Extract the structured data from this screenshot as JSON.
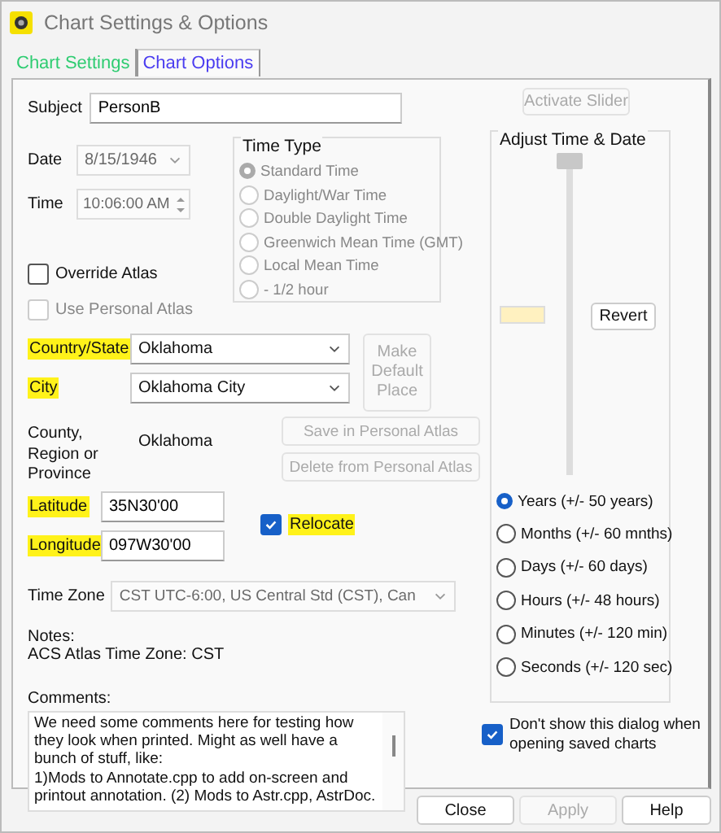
{
  "window": {
    "title": "Chart Settings & Options"
  },
  "tabs": [
    {
      "label": "Chart Settings",
      "selected": false,
      "color": "#2ecc71"
    },
    {
      "label": "Chart Options",
      "selected": true,
      "color": "#4a3cf0"
    }
  ],
  "subject": {
    "label": "Subject",
    "value": "PersonB"
  },
  "date": {
    "label": "Date",
    "value": "8/15/1946",
    "disabled": true
  },
  "time": {
    "label": "Time",
    "value": "10:06:00 AM",
    "disabled": true
  },
  "time_type": {
    "title": "Time Type",
    "disabled": true,
    "options": [
      {
        "label": "Standard Time",
        "selected": true
      },
      {
        "label": "Daylight/War Time",
        "selected": false
      },
      {
        "label": "Double Daylight Time",
        "selected": false
      },
      {
        "label": "Greenwich Mean Time (GMT)",
        "selected": false
      },
      {
        "label": "Local Mean Time",
        "selected": false
      },
      {
        "label": "- 1/2 hour",
        "selected": false
      }
    ]
  },
  "atlas_options": [
    {
      "label": "Override Atlas",
      "checked": false,
      "disabled": false
    },
    {
      "label": "Use Personal Atlas",
      "checked": false,
      "disabled": true
    }
  ],
  "country": {
    "label": "Country/State",
    "highlighted": true,
    "value": "Oklahoma"
  },
  "city": {
    "label": "City",
    "highlighted": true,
    "value": "Oklahoma City"
  },
  "make_default": {
    "label": "Make Default Place",
    "disabled": true
  },
  "county": {
    "label": "County, Region or Province",
    "value": "Oklahoma"
  },
  "atlas_buttons": [
    {
      "label": "Save in Personal Atlas",
      "disabled": true
    },
    {
      "label": "Delete from Personal Atlas",
      "disabled": true
    }
  ],
  "latitude": {
    "label": "Latitude",
    "highlighted": true,
    "value": "35N30'00"
  },
  "longitude": {
    "label": "Longitude",
    "highlighted": true,
    "value": "097W30'00"
  },
  "relocate": {
    "label": "Relocate",
    "checked": true,
    "highlighted": true
  },
  "time_zone": {
    "label": "Time Zone",
    "value": "CST UTC-6:00, US Central Std (CST), Can",
    "disabled": true
  },
  "notes": {
    "label": "Notes:",
    "text": "ACS Atlas Time Zone: CST"
  },
  "comments": {
    "label": "Comments:",
    "value": "We need some comments here for testing how they look when printed. Might as well have a bunch of stuff, like:\n1)Mods to Annotate.cpp to add on-screen and printout annotation. (2) Mods to Astr.cpp, AstrDoc."
  },
  "activate_slider": {
    "label": "Activate Slider",
    "disabled": true
  },
  "adjust": {
    "title": "Adjust Time & Date",
    "level": 0,
    "revert": "Revert",
    "ranges": [
      {
        "label": "Years (+/- 50 years)",
        "selected": true
      },
      {
        "label": "Months (+/- 60 mnths)",
        "selected": false
      },
      {
        "label": "Days (+/- 60 days)",
        "selected": false
      },
      {
        "label": "Hours (+/- 48 hours)",
        "selected": false
      },
      {
        "label": "Minutes (+/- 120 min)",
        "selected": false
      },
      {
        "label": "Seconds (+/- 120 sec)",
        "selected": false
      }
    ]
  },
  "dont_show": {
    "label": "Don't show this dialog when opening saved charts",
    "checked": true
  },
  "buttons": [
    {
      "label": "Close",
      "disabled": false
    },
    {
      "label": "Apply",
      "disabled": true
    },
    {
      "label": "Help",
      "disabled": false
    }
  ]
}
